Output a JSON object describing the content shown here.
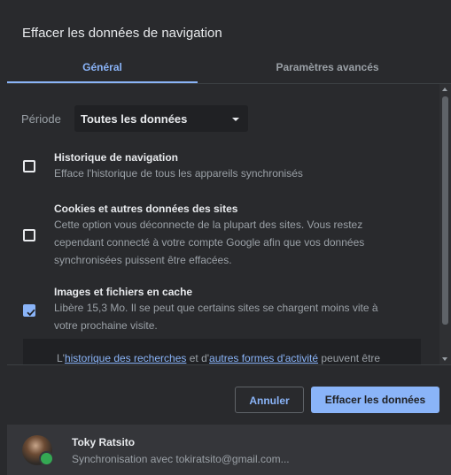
{
  "dialog": {
    "title": "Effacer les données de navigation",
    "tabs": [
      {
        "label": "Général",
        "active": true
      },
      {
        "label": "Paramètres avancés",
        "active": false
      }
    ]
  },
  "period": {
    "label": "Période",
    "selected": "Toutes les données"
  },
  "items": [
    {
      "title": "Historique de navigation",
      "description": "Efface l'historique de tous les appareils synchronisés",
      "checked": false
    },
    {
      "title": "Cookies et autres données des sites",
      "description_lines": [
        "Cette option vous déconnecte de la plupart des sites. Vous restez",
        "cependant connecté à votre compte Google afin que vos données",
        "synchronisées puissent être effacées."
      ],
      "checked": false
    },
    {
      "title": "Images et fichiers en cache",
      "description_lines": [
        "Libère 15,3 Mo. Il se peut que certains sites se chargent moins vite à",
        "votre prochaine visite."
      ],
      "checked": true
    }
  ],
  "notice": {
    "prefix": "L'",
    "link1": "historique des recherches",
    "middle": " et d'",
    "link2": "autres formes d'activité",
    "suffix": " peuvent être"
  },
  "actions": {
    "cancel": "Annuler",
    "clear": "Effacer les données"
  },
  "account": {
    "name": "Toky Ratsito",
    "sync_text": "Synchronisation avec tokiratsito@gmail.com..."
  },
  "colors": {
    "accent": "#8ab4f8",
    "background": "#292a2d",
    "footer": "#35363a"
  }
}
